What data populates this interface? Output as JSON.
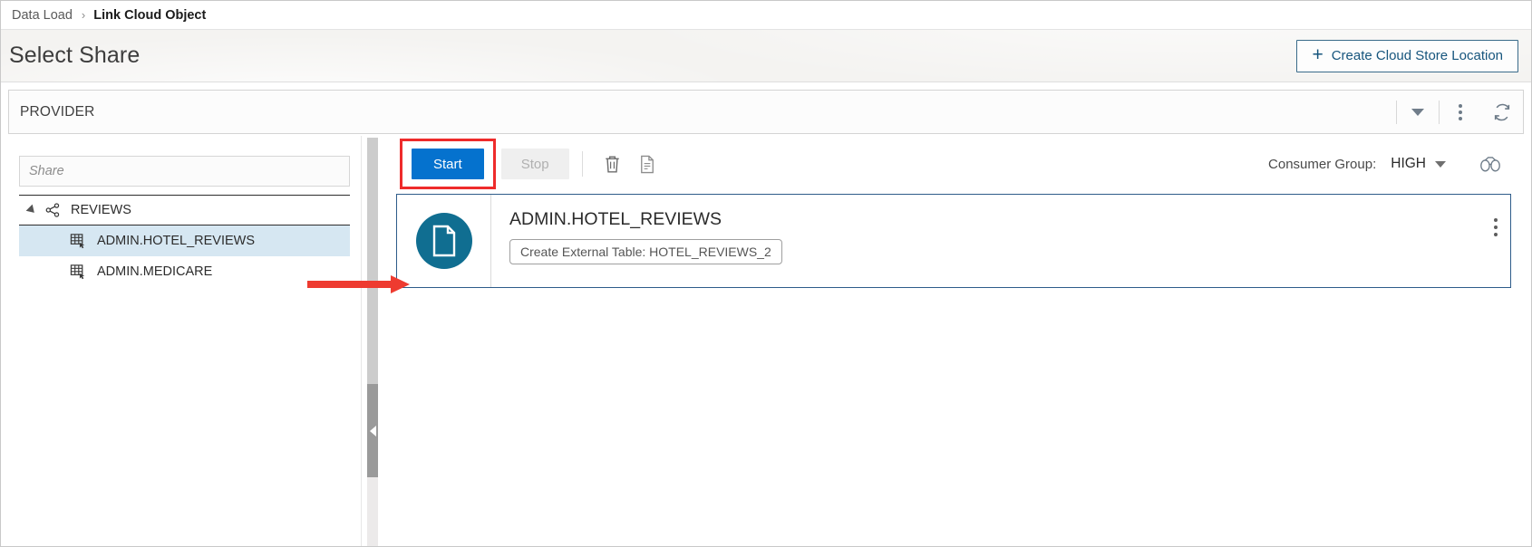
{
  "breadcrumb": {
    "parent": "Data Load",
    "separator": "›",
    "current": "Link Cloud Object"
  },
  "header": {
    "title": "Select Share",
    "create_button": {
      "label": "Create Cloud Store Location",
      "plus": "+",
      "accent": "#16557d"
    }
  },
  "provider_bar": {
    "value": "PROVIDER",
    "dropdown_icon": "chevron-down-icon",
    "more_icon": "kebab-menu-icon",
    "refresh_icon": "refresh-icon"
  },
  "left_pane": {
    "search": {
      "value": "",
      "placeholder": "Share"
    },
    "tree": [
      {
        "label": "REVIEWS",
        "level": 0,
        "icon": "share-network-icon",
        "expanded": true,
        "selected": false
      },
      {
        "label": "ADMIN.HOTEL_REVIEWS",
        "level": 1,
        "icon": "table-link-icon",
        "expanded": false,
        "selected": true
      },
      {
        "label": "ADMIN.MEDICARE",
        "level": 1,
        "icon": "table-link-icon",
        "expanded": false,
        "selected": false
      }
    ]
  },
  "toolbar": {
    "start_label": "Start",
    "stop_label": "Stop",
    "start_enabled": true,
    "stop_enabled": false,
    "start_color": "#0572ce",
    "highlight_color": "#ee2b2b",
    "delete_icon": "trash-icon",
    "report_icon": "document-report-icon",
    "consumer_group_label": "Consumer Group:",
    "consumer_group_value": "HIGH",
    "consumer_group_caret": "chevron-down-icon",
    "preview_icon": "binoculars-icon"
  },
  "card": {
    "icon": "document-icon",
    "icon_bg": "#106e91",
    "title": "ADMIN.HOTEL_REVIEWS",
    "badge": "Create External Table: HOTEL_REVIEWS_2",
    "menu_icon": "kebab-menu-icon",
    "border_color": "#2e5c8a"
  },
  "annotation": {
    "arrow_color": "#ee3b30",
    "arrow_name": "red-pointer-arrow"
  }
}
